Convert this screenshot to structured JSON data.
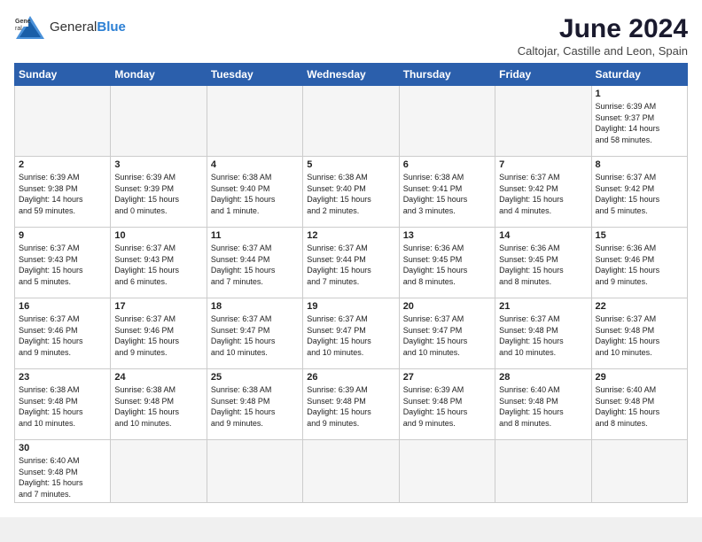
{
  "header": {
    "logo_general": "General",
    "logo_blue": "Blue",
    "month_title": "June 2024",
    "location": "Caltojar, Castille and Leon, Spain"
  },
  "days_of_week": [
    "Sunday",
    "Monday",
    "Tuesday",
    "Wednesday",
    "Thursday",
    "Friday",
    "Saturday"
  ],
  "weeks": [
    [
      {
        "day": "",
        "info": ""
      },
      {
        "day": "",
        "info": ""
      },
      {
        "day": "",
        "info": ""
      },
      {
        "day": "",
        "info": ""
      },
      {
        "day": "",
        "info": ""
      },
      {
        "day": "",
        "info": ""
      },
      {
        "day": "1",
        "info": "Sunrise: 6:39 AM\nSunset: 9:37 PM\nDaylight: 14 hours\nand 58 minutes."
      }
    ],
    [
      {
        "day": "2",
        "info": "Sunrise: 6:39 AM\nSunset: 9:38 PM\nDaylight: 14 hours\nand 59 minutes."
      },
      {
        "day": "3",
        "info": "Sunrise: 6:39 AM\nSunset: 9:39 PM\nDaylight: 15 hours\nand 0 minutes."
      },
      {
        "day": "4",
        "info": "Sunrise: 6:38 AM\nSunset: 9:40 PM\nDaylight: 15 hours\nand 1 minute."
      },
      {
        "day": "5",
        "info": "Sunrise: 6:38 AM\nSunset: 9:40 PM\nDaylight: 15 hours\nand 2 minutes."
      },
      {
        "day": "6",
        "info": "Sunrise: 6:38 AM\nSunset: 9:41 PM\nDaylight: 15 hours\nand 3 minutes."
      },
      {
        "day": "7",
        "info": "Sunrise: 6:37 AM\nSunset: 9:42 PM\nDaylight: 15 hours\nand 4 minutes."
      },
      {
        "day": "8",
        "info": "Sunrise: 6:37 AM\nSunset: 9:42 PM\nDaylight: 15 hours\nand 5 minutes."
      }
    ],
    [
      {
        "day": "9",
        "info": "Sunrise: 6:37 AM\nSunset: 9:43 PM\nDaylight: 15 hours\nand 5 minutes."
      },
      {
        "day": "10",
        "info": "Sunrise: 6:37 AM\nSunset: 9:43 PM\nDaylight: 15 hours\nand 6 minutes."
      },
      {
        "day": "11",
        "info": "Sunrise: 6:37 AM\nSunset: 9:44 PM\nDaylight: 15 hours\nand 7 minutes."
      },
      {
        "day": "12",
        "info": "Sunrise: 6:37 AM\nSunset: 9:44 PM\nDaylight: 15 hours\nand 7 minutes."
      },
      {
        "day": "13",
        "info": "Sunrise: 6:36 AM\nSunset: 9:45 PM\nDaylight: 15 hours\nand 8 minutes."
      },
      {
        "day": "14",
        "info": "Sunrise: 6:36 AM\nSunset: 9:45 PM\nDaylight: 15 hours\nand 8 minutes."
      },
      {
        "day": "15",
        "info": "Sunrise: 6:36 AM\nSunset: 9:46 PM\nDaylight: 15 hours\nand 9 minutes."
      }
    ],
    [
      {
        "day": "16",
        "info": "Sunrise: 6:37 AM\nSunset: 9:46 PM\nDaylight: 15 hours\nand 9 minutes."
      },
      {
        "day": "17",
        "info": "Sunrise: 6:37 AM\nSunset: 9:46 PM\nDaylight: 15 hours\nand 9 minutes."
      },
      {
        "day": "18",
        "info": "Sunrise: 6:37 AM\nSunset: 9:47 PM\nDaylight: 15 hours\nand 10 minutes."
      },
      {
        "day": "19",
        "info": "Sunrise: 6:37 AM\nSunset: 9:47 PM\nDaylight: 15 hours\nand 10 minutes."
      },
      {
        "day": "20",
        "info": "Sunrise: 6:37 AM\nSunset: 9:47 PM\nDaylight: 15 hours\nand 10 minutes."
      },
      {
        "day": "21",
        "info": "Sunrise: 6:37 AM\nSunset: 9:48 PM\nDaylight: 15 hours\nand 10 minutes."
      },
      {
        "day": "22",
        "info": "Sunrise: 6:37 AM\nSunset: 9:48 PM\nDaylight: 15 hours\nand 10 minutes."
      }
    ],
    [
      {
        "day": "23",
        "info": "Sunrise: 6:38 AM\nSunset: 9:48 PM\nDaylight: 15 hours\nand 10 minutes."
      },
      {
        "day": "24",
        "info": "Sunrise: 6:38 AM\nSunset: 9:48 PM\nDaylight: 15 hours\nand 10 minutes."
      },
      {
        "day": "25",
        "info": "Sunrise: 6:38 AM\nSunset: 9:48 PM\nDaylight: 15 hours\nand 9 minutes."
      },
      {
        "day": "26",
        "info": "Sunrise: 6:39 AM\nSunset: 9:48 PM\nDaylight: 15 hours\nand 9 minutes."
      },
      {
        "day": "27",
        "info": "Sunrise: 6:39 AM\nSunset: 9:48 PM\nDaylight: 15 hours\nand 9 minutes."
      },
      {
        "day": "28",
        "info": "Sunrise: 6:40 AM\nSunset: 9:48 PM\nDaylight: 15 hours\nand 8 minutes."
      },
      {
        "day": "29",
        "info": "Sunrise: 6:40 AM\nSunset: 9:48 PM\nDaylight: 15 hours\nand 8 minutes."
      }
    ],
    [
      {
        "day": "30",
        "info": "Sunrise: 6:40 AM\nSunset: 9:48 PM\nDaylight: 15 hours\nand 7 minutes."
      },
      {
        "day": "",
        "info": ""
      },
      {
        "day": "",
        "info": ""
      },
      {
        "day": "",
        "info": ""
      },
      {
        "day": "",
        "info": ""
      },
      {
        "day": "",
        "info": ""
      },
      {
        "day": "",
        "info": ""
      }
    ]
  ]
}
